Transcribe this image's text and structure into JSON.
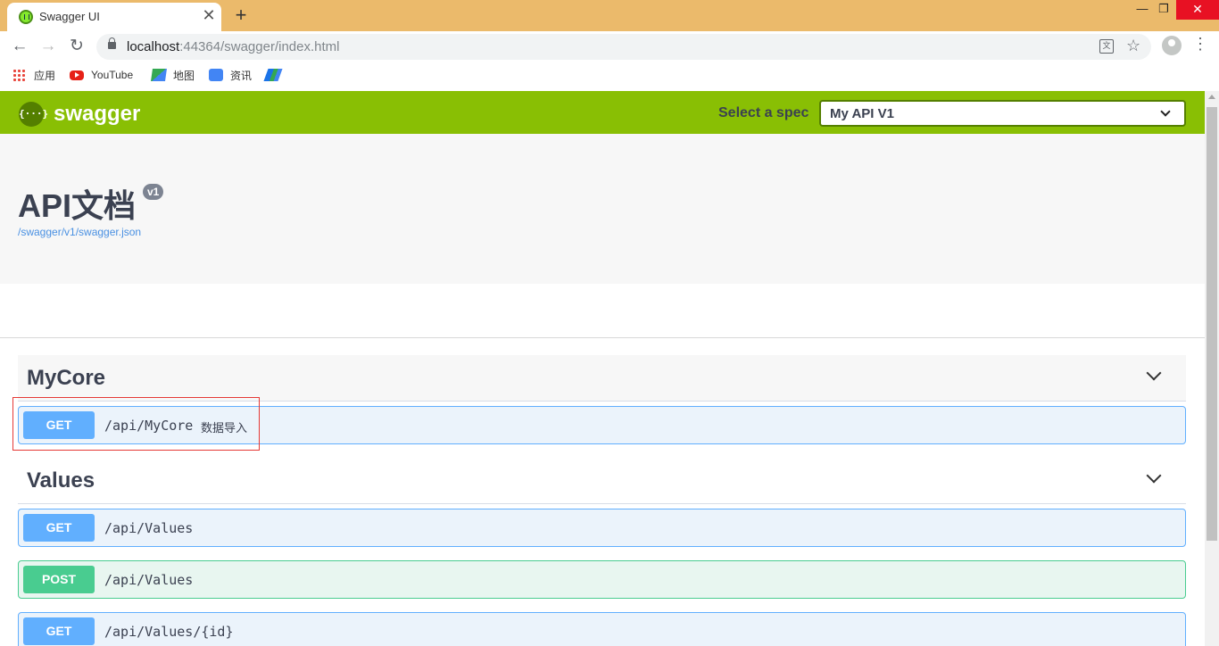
{
  "browser": {
    "tab_title": "Swagger UI",
    "tab_close": "✕",
    "new_tab": "+",
    "url_host": "localhost",
    "url_rest": ":44364/swagger/index.html",
    "window_controls": {
      "minimize": "—",
      "maximize": "❐",
      "close": "✕"
    },
    "bookmarks": [
      {
        "label": "应用",
        "icon": "apps-grid-icon"
      },
      {
        "label": "YouTube",
        "icon": "youtube-icon"
      },
      {
        "label": "地图",
        "icon": "maps-icon"
      },
      {
        "label": "资讯",
        "icon": "news-icon"
      },
      {
        "label": "",
        "icon": "extension-icon"
      }
    ]
  },
  "swagger": {
    "brand": "swagger",
    "logo_glyph": "{···}",
    "select_spec_label": "Select a spec",
    "selected_spec": "My API V1",
    "title": "API文档",
    "version": "v1",
    "spec_link": "/swagger/v1/swagger.json",
    "tags": [
      {
        "name": "MyCore",
        "operations": [
          {
            "method": "GET",
            "path": "/api/MyCore",
            "summary": "数据导入"
          }
        ]
      },
      {
        "name": "Values",
        "operations": [
          {
            "method": "GET",
            "path": "/api/Values",
            "summary": ""
          },
          {
            "method": "POST",
            "path": "/api/Values",
            "summary": ""
          },
          {
            "method": "GET",
            "path": "/api/Values/{id}",
            "summary": ""
          }
        ]
      }
    ]
  },
  "colors": {
    "topbar": "#89bf04",
    "get": "#61affe",
    "post": "#49cc90",
    "highlight_box": "#e53935"
  }
}
